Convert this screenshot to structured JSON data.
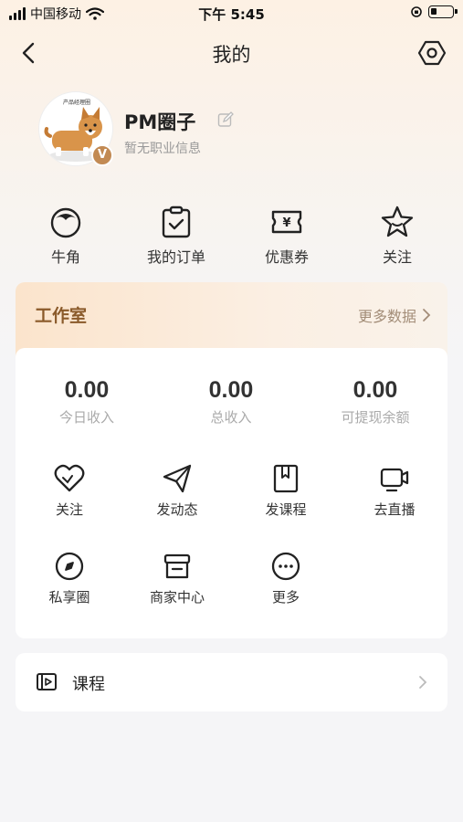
{
  "status_bar": {
    "carrier": "中国移动",
    "time": "下午 5:45"
  },
  "nav": {
    "title": "我的"
  },
  "profile": {
    "avatar_caption": "产品经理圈",
    "name": "PM圈子",
    "subtitle": "暂无职业信息",
    "badge": "V"
  },
  "quick_actions": [
    {
      "label": "牛角",
      "icon": "horn-circle-icon"
    },
    {
      "label": "我的订单",
      "icon": "clipboard-check-icon"
    },
    {
      "label": "优惠券",
      "icon": "coupon-yen-icon"
    },
    {
      "label": "关注",
      "icon": "star-face-icon"
    }
  ],
  "studio": {
    "title": "工作室",
    "more": "更多数据",
    "stats": [
      {
        "value": "0.00",
        "label": "今日收入"
      },
      {
        "value": "0.00",
        "label": "总收入"
      },
      {
        "value": "0.00",
        "label": "可提现余额"
      }
    ],
    "tools": [
      {
        "label": "关注",
        "icon": "heart-icon"
      },
      {
        "label": "发动态",
        "icon": "paper-plane-icon"
      },
      {
        "label": "发课程",
        "icon": "book-icon"
      },
      {
        "label": "去直播",
        "icon": "video-camera-icon"
      },
      {
        "label": "私享圈",
        "icon": "compass-icon"
      },
      {
        "label": "商家中心",
        "icon": "store-icon"
      },
      {
        "label": "更多",
        "icon": "more-dots-icon"
      }
    ]
  },
  "course": {
    "label": "课程"
  },
  "colors": {
    "accent_brown": "#8a5a2a",
    "badge_gold": "#c28a53",
    "muted_text": "#aaaaaa"
  }
}
